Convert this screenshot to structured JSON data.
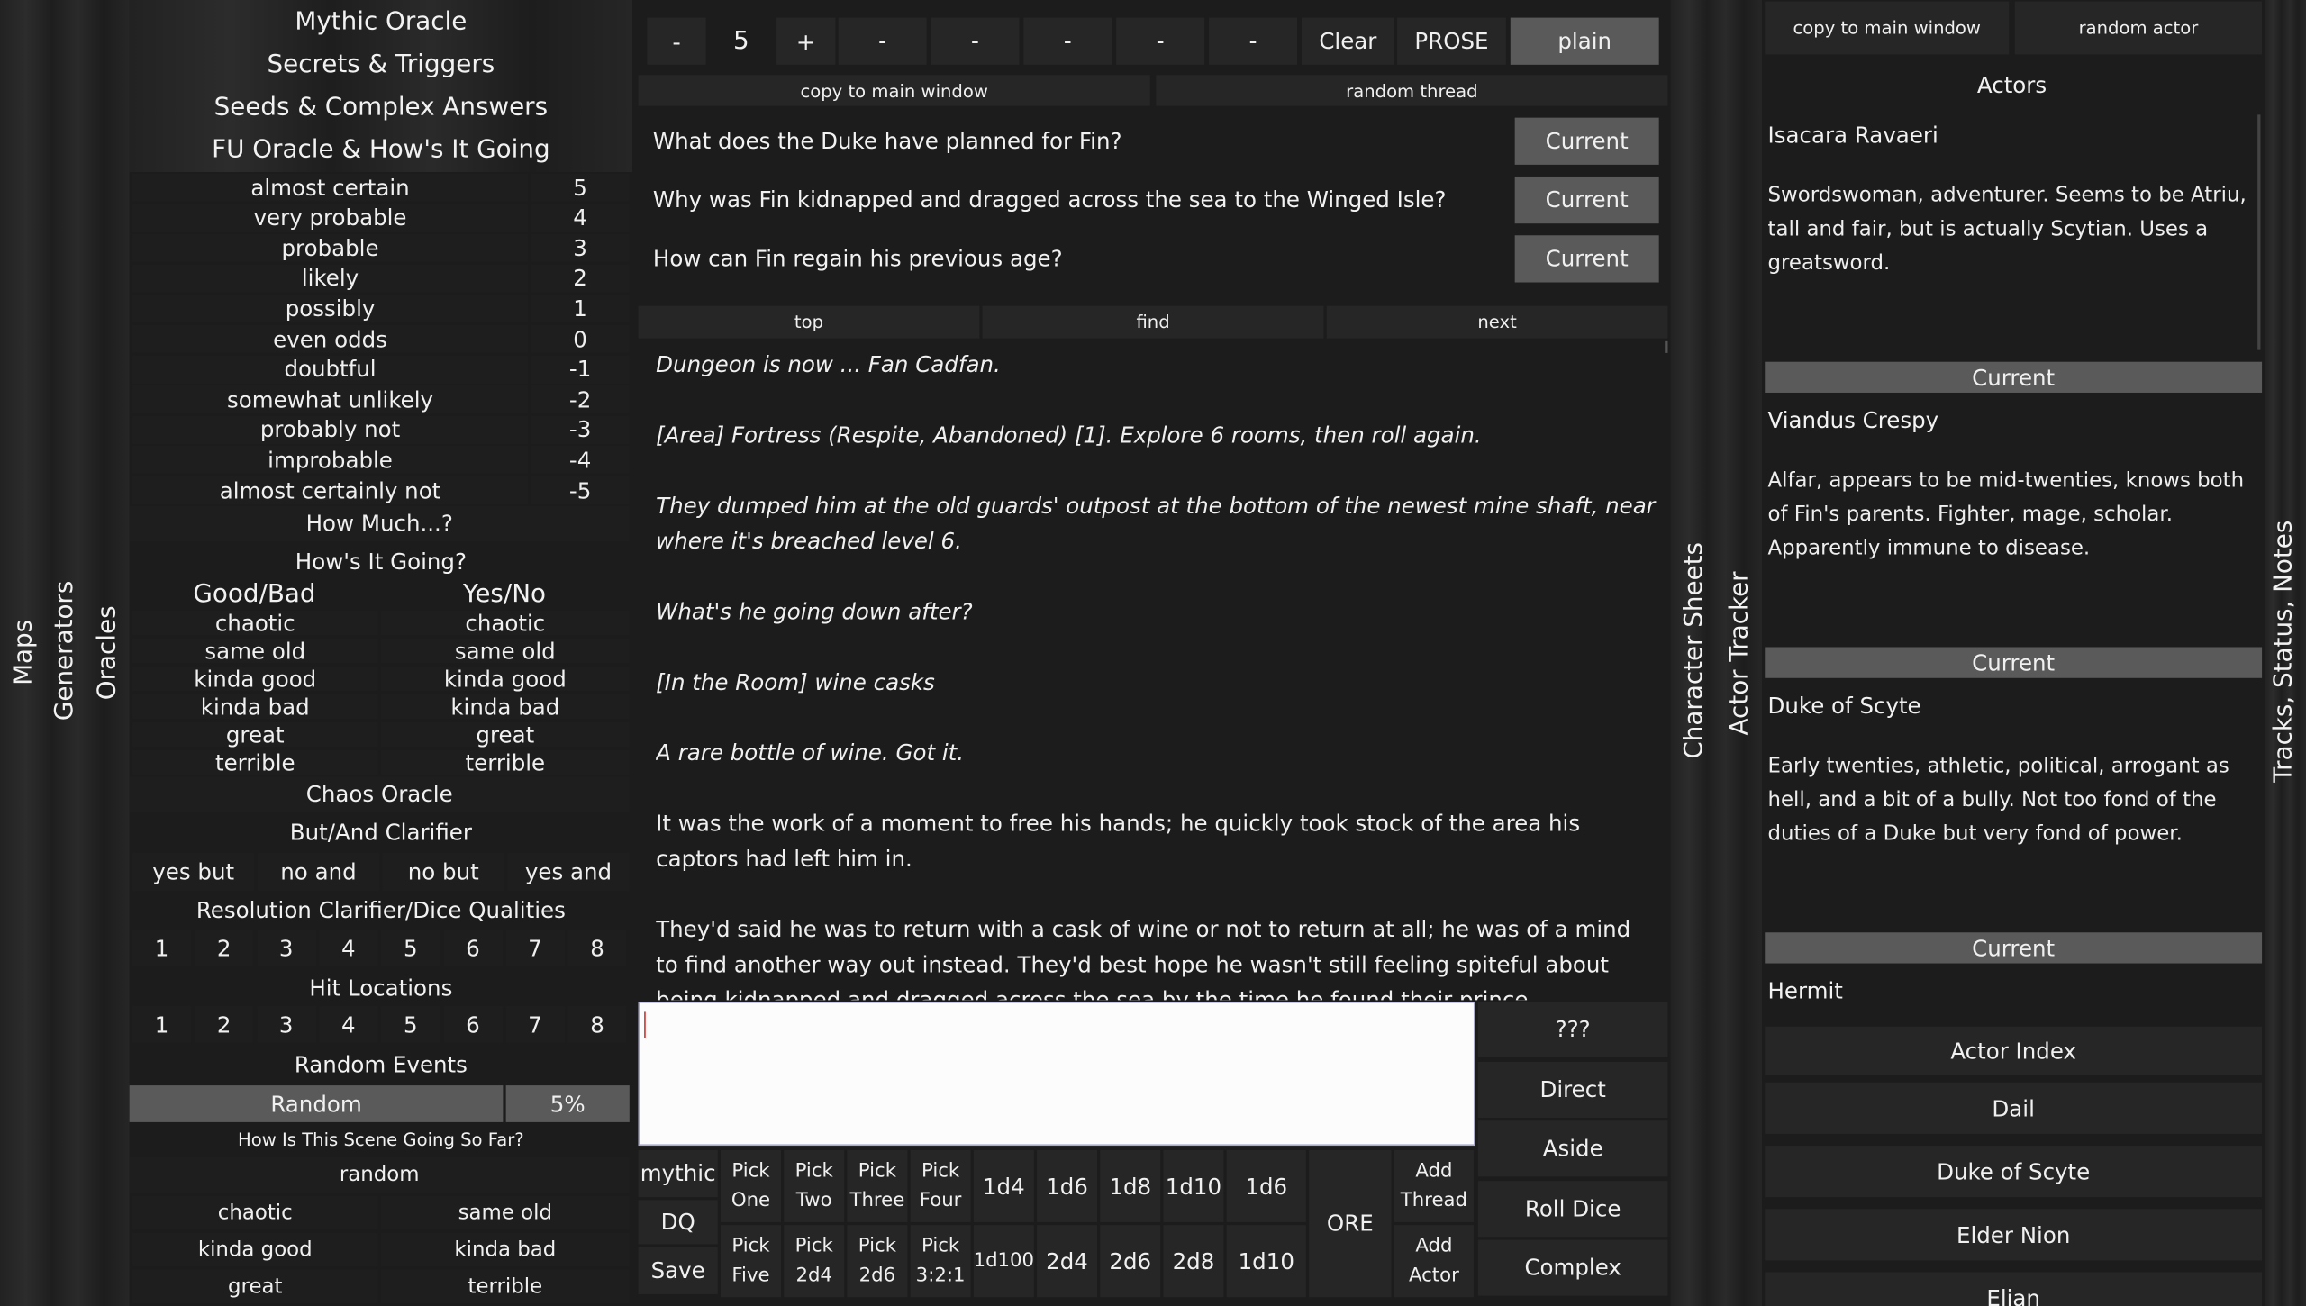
{
  "left_tabs": [
    "Maps",
    "Generators",
    "Oracles"
  ],
  "oracle_menu": [
    "Mythic Oracle",
    "Secrets & Triggers",
    "Seeds & Complex Answers",
    "FU Oracle & How's It Going"
  ],
  "odds": [
    {
      "label": "almost certain",
      "value": "5"
    },
    {
      "label": "very probable",
      "value": "4"
    },
    {
      "label": "probable",
      "value": "3"
    },
    {
      "label": "likely",
      "value": "2"
    },
    {
      "label": "possibly",
      "value": "1"
    },
    {
      "label": "even odds",
      "value": "0"
    },
    {
      "label": "doubtful",
      "value": "-1"
    },
    {
      "label": "somewhat unlikely",
      "value": "-2"
    },
    {
      "label": "probably not",
      "value": "-3"
    },
    {
      "label": "improbable",
      "value": "-4"
    },
    {
      "label": "almost certainly not",
      "value": "-5"
    }
  ],
  "how_much": "How Much...?",
  "hows_it_going": {
    "title": "How's It Going?",
    "col1": "Good/Bad",
    "col2": "Yes/No",
    "rows": [
      [
        "chaotic",
        "chaotic"
      ],
      [
        "same old",
        "same old"
      ],
      [
        "kinda good",
        "kinda good"
      ],
      [
        "kinda bad",
        "kinda bad"
      ],
      [
        "great",
        "great"
      ],
      [
        "terrible",
        "terrible"
      ]
    ]
  },
  "chaos_oracle": "Chaos Oracle",
  "but_and": {
    "title": "But/And Clarifier",
    "options": [
      "yes but",
      "no and",
      "no but",
      "yes and"
    ]
  },
  "resolution": {
    "title": "Resolution Clarifier/Dice Qualities",
    "numbers": [
      "1",
      "2",
      "3",
      "4",
      "5",
      "6",
      "7",
      "8"
    ]
  },
  "hit_locations": {
    "title": "Hit Locations",
    "numbers": [
      "1",
      "2",
      "3",
      "4",
      "5",
      "6",
      "7",
      "8"
    ]
  },
  "random_events": {
    "title": "Random Events",
    "random": "Random",
    "percent": "5%"
  },
  "scene": {
    "title": "How Is This Scene Going So Far?",
    "random": "random",
    "rows": [
      [
        "chaotic",
        "same old"
      ],
      [
        "kinda good",
        "kinda bad"
      ],
      [
        "great",
        "terrible"
      ]
    ]
  },
  "toolbar": {
    "minus": "-",
    "value": "5",
    "plus": "+",
    "dashes": [
      "-",
      "-",
      "-",
      "-",
      "-"
    ],
    "clear": "Clear",
    "prose": "PROSE",
    "plain": "plain"
  },
  "threads_bar": {
    "copy": "copy to main window",
    "random": "random thread"
  },
  "threads": [
    {
      "text": "What does the Duke have planned for Fin?",
      "button": "Current"
    },
    {
      "text": "Why was Fin kidnapped and dragged across the sea to the Winged Isle?",
      "button": "Current"
    },
    {
      "text": "How can Fin regain his previous age?",
      "button": "Current"
    }
  ],
  "nav": {
    "top": "top",
    "find": "find",
    "next": "next"
  },
  "story": [
    {
      "text": "Dungeon is now ... Fan Cadfan.",
      "italic": true
    },
    {
      "text": "[Area] Fortress (Respite, Abandoned) [1]. Explore 6 rooms, then roll again.",
      "italic": true
    },
    {
      "text": "They dumped him at the old guards' outpost at the bottom of the newest mine shaft, near where it's breached level 6.",
      "italic": true
    },
    {
      "text": "What's he going down after?",
      "italic": true
    },
    {
      "text": "[In the Room] wine casks",
      "italic": true
    },
    {
      "text": "A rare bottle of wine. Got it.",
      "italic": true
    },
    {
      "text": "It was the work of a moment to free his hands; he quickly took stock of the area his captors had left him in.",
      "italic": false
    },
    {
      "text": "They'd said he was to return with a cask of wine or not to return at all; he was of a mind to find another way out instead. They'd best hope he wasn't still feeling spiteful about being kidnapped and dragged across the sea by the time he found their prince.",
      "italic": false
    }
  ],
  "input_placeholder": "",
  "right_buttons": [
    "???",
    "Direct",
    "Aside",
    "Roll Dice",
    "Complex"
  ],
  "bottom": {
    "mythic": "mythic",
    "dq": "DQ",
    "save": "Save",
    "pick_one": [
      "Pick",
      "One"
    ],
    "pick_two": [
      "Pick",
      "Two"
    ],
    "pick_three": [
      "Pick",
      "Three"
    ],
    "pick_four": [
      "Pick",
      "Four"
    ],
    "pick_five": [
      "Pick",
      "Five"
    ],
    "pick_2d4": [
      "Pick",
      "2d4"
    ],
    "pick_2d6": [
      "Pick",
      "2d6"
    ],
    "pick_321": [
      "Pick",
      "3:2:1"
    ],
    "dice_top": [
      "1d4",
      "1d6",
      "1d8",
      "1d10",
      "1d6"
    ],
    "dice_bottom": [
      "1d100",
      "2d4",
      "2d6",
      "2d8",
      "1d10"
    ],
    "ore": "ORE",
    "add_thread": [
      "Add",
      "Thread"
    ],
    "add_actor": [
      "Add",
      "Actor"
    ]
  },
  "middle_tabs": [
    "Character Sheets",
    "Actor Tracker"
  ],
  "actors_bar": {
    "copy": "copy to main window",
    "random": "random actor"
  },
  "actors_title": "Actors",
  "actors": [
    {
      "name": "Isacara Ravaeri",
      "desc": "Swordswoman, adventurer. Seems to be Atriu, tall and fair, but is actually Scytian. Uses a greatsword.",
      "button": "Current"
    },
    {
      "name": "Viandus Crespy",
      "desc": "Alfar, appears to be mid-twenties, knows both of Fin's parents. Fighter, mage, scholar. Apparently immune to disease.",
      "button": "Current"
    },
    {
      "name": "Duke of Scyte",
      "desc": "Early twenties, athletic, political, arrogant as hell, and a bit of a bully. Not too fond of the duties of a Duke but very fond of power.",
      "button": "Current"
    },
    {
      "name": "Hermit",
      "desc": "",
      "button": ""
    }
  ],
  "actor_index": {
    "title": "Actor Index",
    "items": [
      "Dail",
      "Duke of Scyte",
      "Elder Nion",
      "Elian"
    ]
  },
  "right_tab": "Tracks, Status, Notes"
}
